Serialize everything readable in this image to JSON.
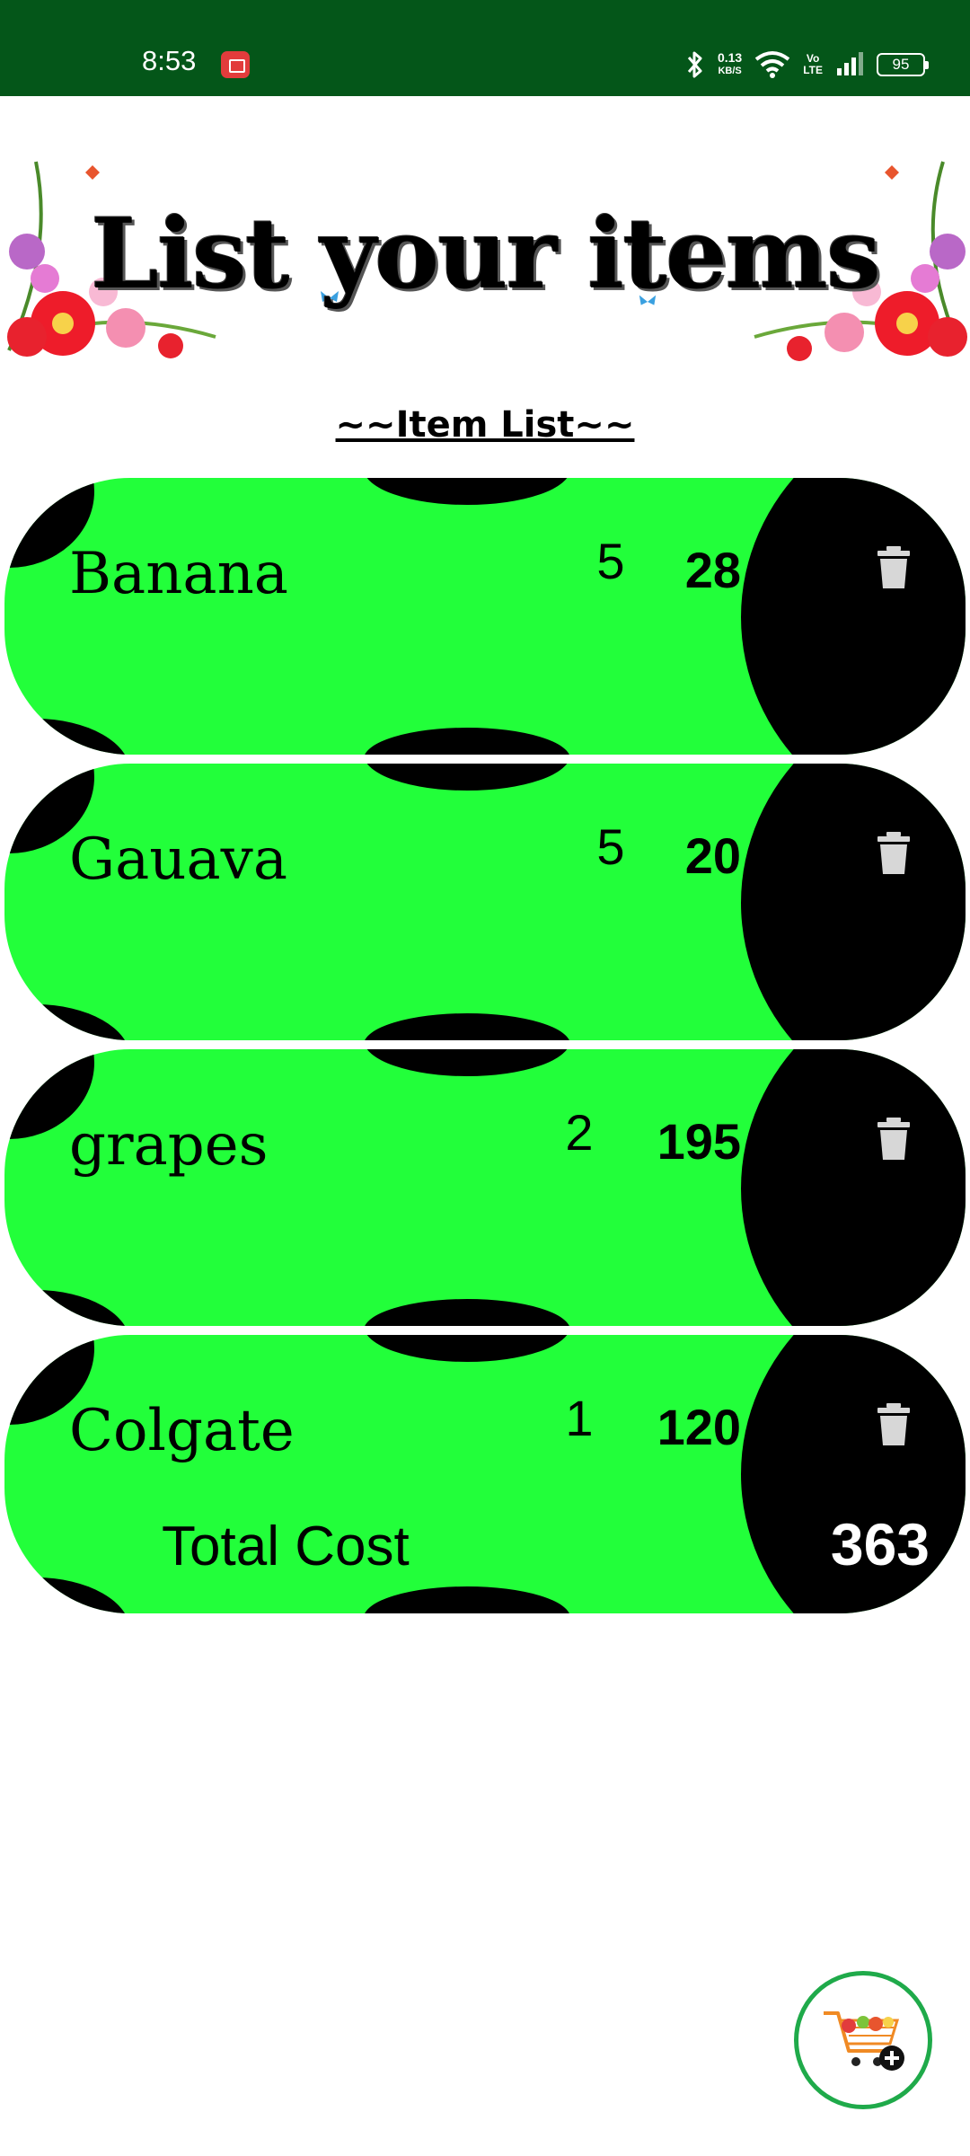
{
  "status_bar": {
    "time": "8:53",
    "net_speed_value": "0.13",
    "net_speed_unit": "KB/S",
    "volte_top": "Vo",
    "volte_bottom": "LTE",
    "battery": "95"
  },
  "header": {
    "banner_title": "List your items",
    "list_heading": "~~Item List~~"
  },
  "items": [
    {
      "name": "Banana",
      "quantity": "5",
      "price": "28"
    },
    {
      "name": "Gauava",
      "quantity": "5",
      "price": "20"
    },
    {
      "name": "grapes",
      "quantity": "2",
      "price": "195"
    },
    {
      "name": "Colgate",
      "quantity": "1",
      "price": "120"
    }
  ],
  "total": {
    "label": "Total Cost",
    "value": "363"
  },
  "icons": {
    "delete": "trash-icon",
    "add_cart": "cart-plus-icon"
  },
  "colors": {
    "status_bar": "#045619",
    "card_green": "#22ff3a",
    "card_black": "#000000",
    "fab_border": "#1faa4a"
  }
}
